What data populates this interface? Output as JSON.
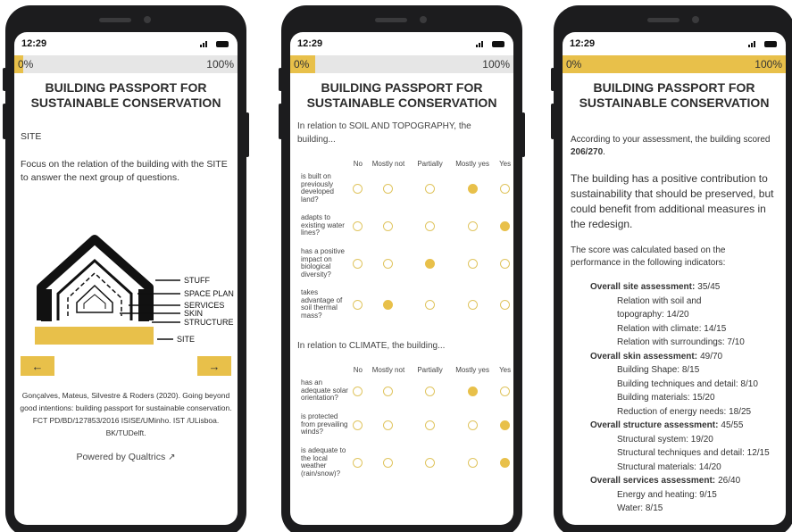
{
  "status_time": "12:29",
  "progress": {
    "left_label": "0%",
    "right_label": "100%",
    "screen1": 0.04,
    "screen2": 0.11,
    "screen3": 1.0
  },
  "accent_color": "#e8c04a",
  "title_line1": "BUILDING PASSPORT FOR",
  "title_line2": "SUSTAINABLE CONSERVATION",
  "screen1": {
    "section_label": "SITE",
    "description": "Focus on the relation of the building with the SITE to answer the next group of questions.",
    "diagram_labels": [
      "STUFF",
      "SPACE PLAN",
      "SERVICES",
      "SKIN",
      "STRUCTURE",
      "SITE"
    ],
    "prev_button": "←",
    "next_button": "→",
    "credit": "Gonçalves, Mateus, Silvestre & Roders (2020). Going beyond good intentions: building passport for sustainable conservation. FCT PD/BD/127853/2016 ISISE/UMinho. IST /ULisboa. BK/TUDelft.",
    "powered_by": "Powered by Qualtrics",
    "powered_icon": "external-link-icon"
  },
  "screen2": {
    "columns": [
      "No",
      "Mostly not",
      "Partially",
      "Mostly yes",
      "Yes"
    ],
    "groups": [
      {
        "question": "In relation to SOIL AND TOPOGRAPHY, the building...",
        "items": [
          {
            "label": "is built on previously developed land?",
            "selected": 3
          },
          {
            "label": "adapts to existing water lines?",
            "selected": 4
          },
          {
            "label": "has a positive impact on biological diversity?",
            "selected": 2
          },
          {
            "label": "takes advantage of soil thermal mass?",
            "selected": 1
          }
        ]
      },
      {
        "question": "In relation to CLIMATE, the building...",
        "items": [
          {
            "label": "has an adequate solar orientation?",
            "selected": 3
          },
          {
            "label": "is protected from prevailing winds?",
            "selected": 4
          },
          {
            "label": "is adequate to the local weather (rain/snow)?",
            "selected": 4
          }
        ]
      }
    ]
  },
  "screen3": {
    "score_intro": "According to your assessment, the building scored",
    "score": "206/270",
    "score_end": ".",
    "verdict": "The building has a positive contribution to sustainability that should be preserved, but could benefit from additional measures in the redesign.",
    "basis": "The score was calculated based on the performance in the following indicators:",
    "indicators": [
      {
        "label": "Overall site assessment:",
        "value": "35/45",
        "subs": [
          "Relation with soil and topography: 14/20",
          "Relation with climate: 14/15",
          "Relation with surroundings: 7/10"
        ]
      },
      {
        "label": "Overall skin assessment:",
        "value": "49/70",
        "subs": [
          "Building Shape: 8/15",
          "Building techniques and detail: 8/10",
          "Building materials: 15/20",
          "Reduction of energy needs: 18/25"
        ]
      },
      {
        "label": "Overall structure assessment:",
        "value": "45/55",
        "subs": [
          "Structural system: 19/20",
          "Structural techniques and detail: 12/15",
          "Structural materials: 14/20"
        ]
      },
      {
        "label": "Overall services assessment:",
        "value": "26/40",
        "subs": [
          "Energy and heating: 9/15",
          "Water: 8/15"
        ]
      }
    ]
  }
}
